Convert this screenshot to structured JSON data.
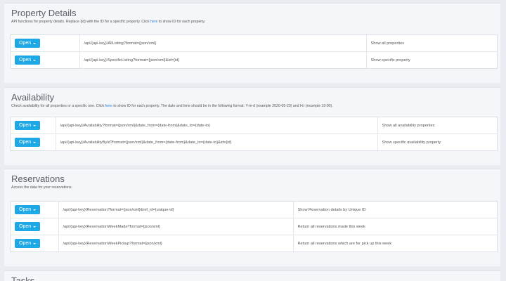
{
  "sections": [
    {
      "title": "Property Details",
      "desc_before": "API functions for property details. Replace {id} with the ID for a specific property. Click ",
      "desc_link": "here",
      "desc_after": " to show ID for each property.",
      "rows": [
        {
          "button": "Open",
          "endpoint": "/api/{api-key}/AllListing?format={json/xml}",
          "description": "Show all properties"
        },
        {
          "button": "Open",
          "endpoint": "/api/{api-key}/SpecificListing?format={json/xml}&id={id}",
          "description": "Show specific property"
        }
      ]
    },
    {
      "title": "Availability",
      "desc_before": "Check availability for all properties or a specific one. Click ",
      "desc_link": "here",
      "desc_after": " to show ID for each property. The date and time should be in the following format: Y-m-d (example 2020-05-23) and H:i (example 10:00).",
      "rows": [
        {
          "button": "Open",
          "endpoint": "/api/{api-key}/Availability?format={json/xml}&date_from={date-from}&date_to={date-to}",
          "description": "Show all availability properties"
        },
        {
          "button": "Open",
          "endpoint": "/api/{api-key}/AvailabilityById?format={json/xml}&date_from={date-from}&date_to={date-to}&id={id}",
          "description": "Show specific availability property"
        }
      ]
    },
    {
      "title": "Reservations",
      "desc_before": "Access the data for your reservations.",
      "desc_link": "",
      "desc_after": "",
      "rows": [
        {
          "button": "Open",
          "endpoint": "/api/{api-key}/Reservation?format={json/xml}&ref_id={unique-id}",
          "description": "Show Reservation details by Unique ID"
        },
        {
          "button": "Open",
          "endpoint": "/api/{api-key}/ReservationWeekMade?format={json/xml}",
          "description": "Return all reservations made this week"
        },
        {
          "button": "Open",
          "endpoint": "/api/{api-key}/ReservationWeekPickup?format={json/xml}",
          "description": "Return all reservations which are for pick up this week"
        }
      ]
    },
    {
      "title": "Tasks"
    }
  ]
}
